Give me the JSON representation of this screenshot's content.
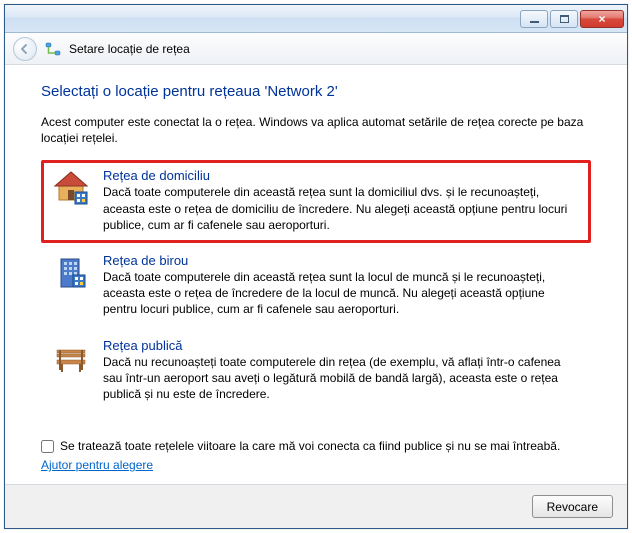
{
  "header": {
    "title": "Setare locație de rețea"
  },
  "main": {
    "heading": "Selectați o locație pentru rețeaua 'Network  2'",
    "intro": "Acest computer este conectat la o rețea. Windows va aplica automat setările de rețea corecte pe baza locației rețelei.",
    "options": [
      {
        "title": "Rețea de domiciliu",
        "description": "Dacă toate computerele din această rețea sunt la domiciliul dvs. și le recunoașteți, aceasta este o rețea de domiciliu de încredere. Nu alegeți această opțiune pentru locuri publice, cum ar fi cafenele sau aeroporturi."
      },
      {
        "title": "Rețea de birou",
        "description": "Dacă toate computerele din această rețea sunt la locul de muncă și le recunoașteți, aceasta este o rețea de încredere de la locul de muncă. Nu alegeți această opțiune pentru locuri publice, cum ar fi cafenele sau aeroporturi."
      },
      {
        "title": "Rețea publică",
        "description": "Dacă nu recunoașteți toate computerele din rețea (de exemplu, vă aflați într-o cafenea sau într-un aeroport sau aveți o legătură mobilă de bandă largă), aceasta este o rețea publică și nu este de încredere."
      }
    ],
    "treat_future_label": "Se tratează toate rețelele viitoare la care mă voi conecta ca fiind publice și nu se mai întreabă.",
    "help_link": "Ajutor pentru alegere"
  },
  "buttons": {
    "cancel": "Revocare"
  }
}
